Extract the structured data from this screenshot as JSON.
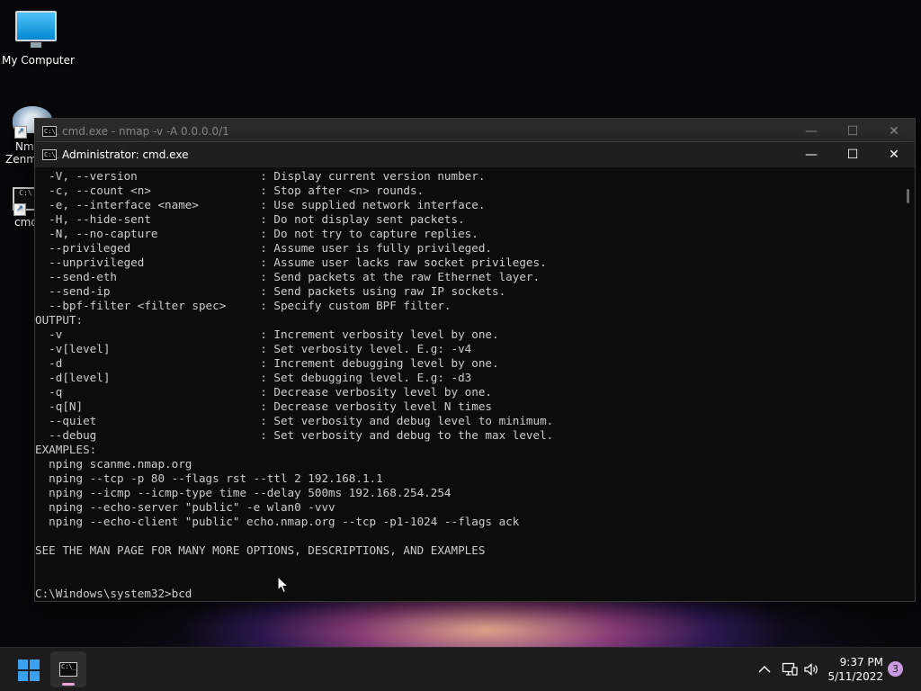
{
  "desktop": {
    "icons": [
      {
        "label": "My Computer",
        "icon": "computer-icon"
      },
      {
        "label": "Nm",
        "label2": "Zenm",
        "icon": "nmap-zenmap-icon"
      },
      {
        "label": "cmd",
        "icon": "cmd-icon"
      }
    ]
  },
  "windows": {
    "back": {
      "title": "cmd.exe - nmap  -v -A 0.0.0.0/1",
      "icon_text": "C:\\_"
    },
    "front": {
      "title": "Administrator: cmd.exe",
      "icon_text": "C:\\_",
      "minimize_label": "—",
      "maximize_label": "☐",
      "close_label": "✕"
    }
  },
  "console": {
    "lines": [
      "  -V, --version                  : Display current version number.",
      "  -c, --count <n>                : Stop after <n> rounds.",
      "  -e, --interface <name>         : Use supplied network interface.",
      "  -H, --hide-sent                : Do not display sent packets.",
      "  -N, --no-capture               : Do not try to capture replies.",
      "  --privileged                   : Assume user is fully privileged.",
      "  --unprivileged                 : Assume user lacks raw socket privileges.",
      "  --send-eth                     : Send packets at the raw Ethernet layer.",
      "  --send-ip                      : Send packets using raw IP sockets.",
      "  --bpf-filter <filter spec>     : Specify custom BPF filter.",
      "OUTPUT:",
      "  -v                             : Increment verbosity level by one.",
      "  -v[level]                      : Set verbosity level. E.g: -v4",
      "  -d                             : Increment debugging level by one.",
      "  -d[level]                      : Set debugging level. E.g: -d3",
      "  -q                             : Decrease verbosity level by one.",
      "  -q[N]                          : Decrease verbosity level N times",
      "  --quiet                        : Set verbosity and debug level to minimum.",
      "  --debug                        : Set verbosity and debug to the max level.",
      "EXAMPLES:",
      "  nping scanme.nmap.org",
      "  nping --tcp -p 80 --flags rst --ttl 2 192.168.1.1",
      "  nping --icmp --icmp-type time --delay 500ms 192.168.254.254",
      "  nping --echo-server \"public\" -e wlan0 -vvv",
      "  nping --echo-client \"public\" echo.nmap.org --tcp -p1-1024 --flags ack",
      "",
      "SEE THE MAN PAGE FOR MANY MORE OPTIONS, DESCRIPTIONS, AND EXAMPLES",
      "",
      "",
      "C:\\Windows\\system32>bcd"
    ]
  },
  "taskbar": {
    "start_icon": "windows-start-icon",
    "pinned": [
      {
        "app": "cmd",
        "icon_text": "C:\\_"
      }
    ],
    "tray": {
      "chevron": "^",
      "network": "🖧",
      "volume": "🔊"
    },
    "time": "9:37 PM",
    "date": "5/11/2022",
    "notifications": "3"
  }
}
